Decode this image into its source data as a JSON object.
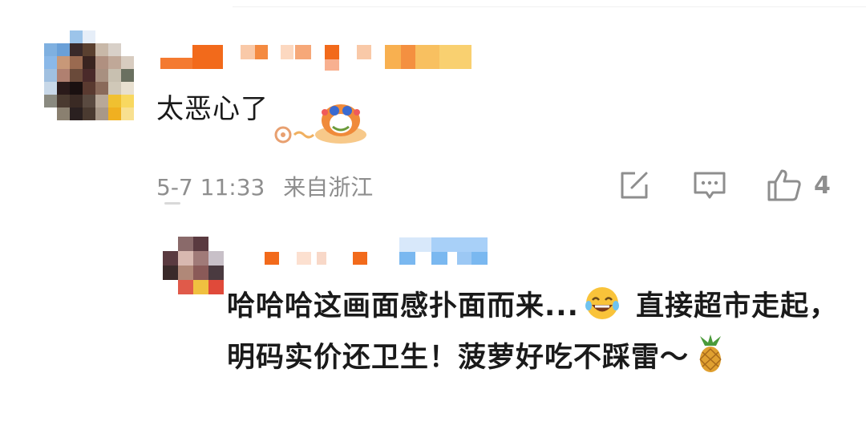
{
  "comment": {
    "text": "太恶心了",
    "timestamp": "5-7 11:33",
    "location": "来自浙江",
    "like_count": "4",
    "actions": [
      "share-icon",
      "comment-icon",
      "like-icon"
    ]
  },
  "reply": {
    "text_part1": "哈哈哈这画面感扑面而来...",
    "text_part2": " 直接超市走起，明码实价还卫生！菠萝好吃不踩雷～",
    "emoji_1": "laughing-tears-emoji",
    "emoji_2": "pineapple-emoji"
  },
  "colors": {
    "text": "#1a1a1a",
    "meta": "#8e8e8e",
    "username_orange": "#f26a1b",
    "username_blue": "#7ab8f0"
  }
}
